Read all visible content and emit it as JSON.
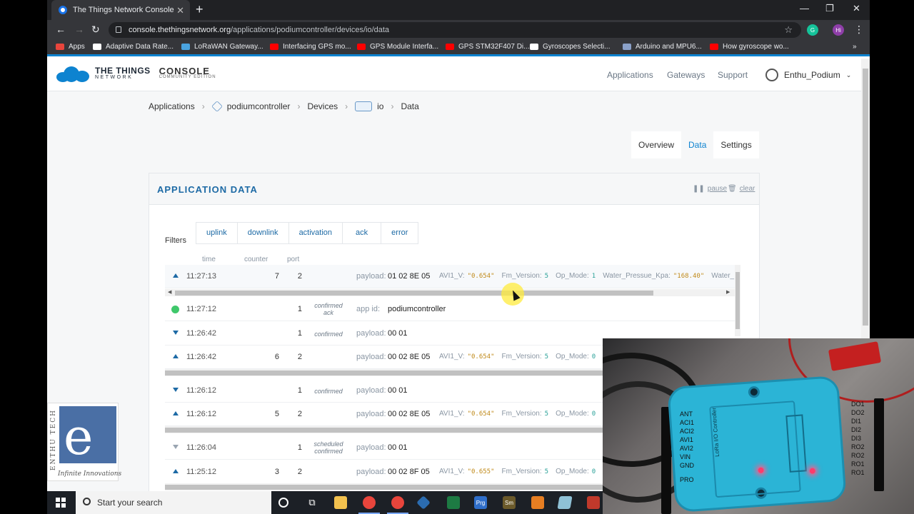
{
  "browser": {
    "tab_title": "The Things Network Console",
    "new_tab": "+",
    "url_host": "console.thethingsnetwork.org",
    "url_path": "/applications/podiumcontroller/devices/io/data",
    "profile_initial": "Hi",
    "bookmarks": [
      {
        "label": "Apps",
        "color": "#e8453c"
      },
      {
        "label": "Adaptive Data Rate...",
        "color": "#ffffff"
      },
      {
        "label": "LoRaWAN Gateway...",
        "color": "#4aa3df"
      },
      {
        "label": "Interfacing GPS mo...",
        "color": "#ff0000"
      },
      {
        "label": "GPS Module Interfa...",
        "color": "#ff0000"
      },
      {
        "label": "GPS STM32F407 Di...",
        "color": "#ff0000"
      },
      {
        "label": "Gyroscopes Selecti...",
        "color": "#ffffff"
      },
      {
        "label": "Arduino and MPU6...",
        "color": "#8aa0c8"
      },
      {
        "label": "How gyroscope wo...",
        "color": "#ff0000"
      }
    ]
  },
  "header": {
    "brand_line1": "THE THINGS",
    "brand_line2": "NETWORK",
    "console_title": "CONSOLE",
    "console_sub": "COMMUNITY EDITION",
    "nav": [
      "Applications",
      "Gateways",
      "Support"
    ],
    "user": "Enthu_Podium"
  },
  "breadcrumb": [
    "Applications",
    "podiumcontroller",
    "Devices",
    "io",
    "Data"
  ],
  "subtabs": [
    {
      "label": "Overview",
      "active": false
    },
    {
      "label": "Data",
      "active": true
    },
    {
      "label": "Settings",
      "active": false
    }
  ],
  "panel": {
    "title": "APPLICATION DATA",
    "pause": "pause",
    "clear": "clear",
    "filters_label": "Filters",
    "filters": [
      "uplink",
      "downlink",
      "activation",
      "ack",
      "error"
    ],
    "columns": {
      "time": "time",
      "counter": "counter",
      "port": "port"
    }
  },
  "rows": [
    {
      "dir": "up",
      "time": "11:27:13",
      "counter": "7",
      "port": "2",
      "tag": "",
      "label": "payload:",
      "value": "01 02 8E 05",
      "fields": [
        "AVI1_V:",
        "\"0.654\"",
        "Fm_Version:",
        "5",
        "Op_Mode:",
        "1",
        "Water_Pressue_Kpa:",
        "\"168.40\"",
        "Water_"
      ]
    },
    {
      "dir": "ack",
      "time": "11:27:12",
      "counter": "",
      "port": "1",
      "tag": "confirmed",
      "tag2": "ack",
      "label": "app id:",
      "value": "podiumcontroller",
      "fields": []
    },
    {
      "dir": "down",
      "time": "11:26:42",
      "counter": "",
      "port": "1",
      "tag": "confirmed",
      "label": "payload:",
      "value": "00 01",
      "fields": []
    },
    {
      "dir": "up",
      "time": "11:26:42",
      "counter": "6",
      "port": "2",
      "tag": "",
      "label": "payload:",
      "value": "00 02 8E 05",
      "fields": [
        "AVI1_V:",
        "\"0.654\"",
        "Fm_Version:",
        "5",
        "Op_Mode:",
        "0"
      ]
    },
    {
      "dir": "down",
      "time": "11:26:12",
      "counter": "",
      "port": "1",
      "tag": "confirmed",
      "label": "payload:",
      "value": "00 01",
      "fields": []
    },
    {
      "dir": "up",
      "time": "11:26:12",
      "counter": "5",
      "port": "2",
      "tag": "",
      "label": "payload:",
      "value": "00 02 8E 05",
      "fields": [
        "AVI1_V:",
        "\"0.654\"",
        "Fm_Version:",
        "5",
        "Op_Mode:",
        "0"
      ]
    },
    {
      "dir": "down-grey",
      "time": "11:26:04",
      "counter": "",
      "port": "1",
      "tag": "scheduled",
      "tag2": "confirmed",
      "label": "payload:",
      "value": "00 01",
      "fields": []
    },
    {
      "dir": "up",
      "time": "11:25:12",
      "counter": "3",
      "port": "2",
      "tag": "",
      "label": "payload:",
      "value": "00 02 8F 05",
      "fields": [
        "AVI1_V:",
        "\"0.655\"",
        "Fm_Version:",
        "5",
        "Op_Mode:",
        "0"
      ]
    }
  ],
  "taskbar": {
    "search_placeholder": "Start your search"
  },
  "overlay": {
    "logo_side": "ENTHU TECH",
    "logo_tagline": "Infinite Innovations",
    "device_title": "LoRa I/O Controller",
    "left_terminals": [
      "ANT",
      "ACI1",
      "ACI2",
      "AVI1",
      "AVI2",
      "VIN",
      "GND",
      "PRO"
    ],
    "right_terminals": [
      "DO1",
      "DO2",
      "DI1",
      "DI2",
      "DI3",
      "RO2",
      "RO2",
      "RO1",
      "RO1"
    ]
  }
}
